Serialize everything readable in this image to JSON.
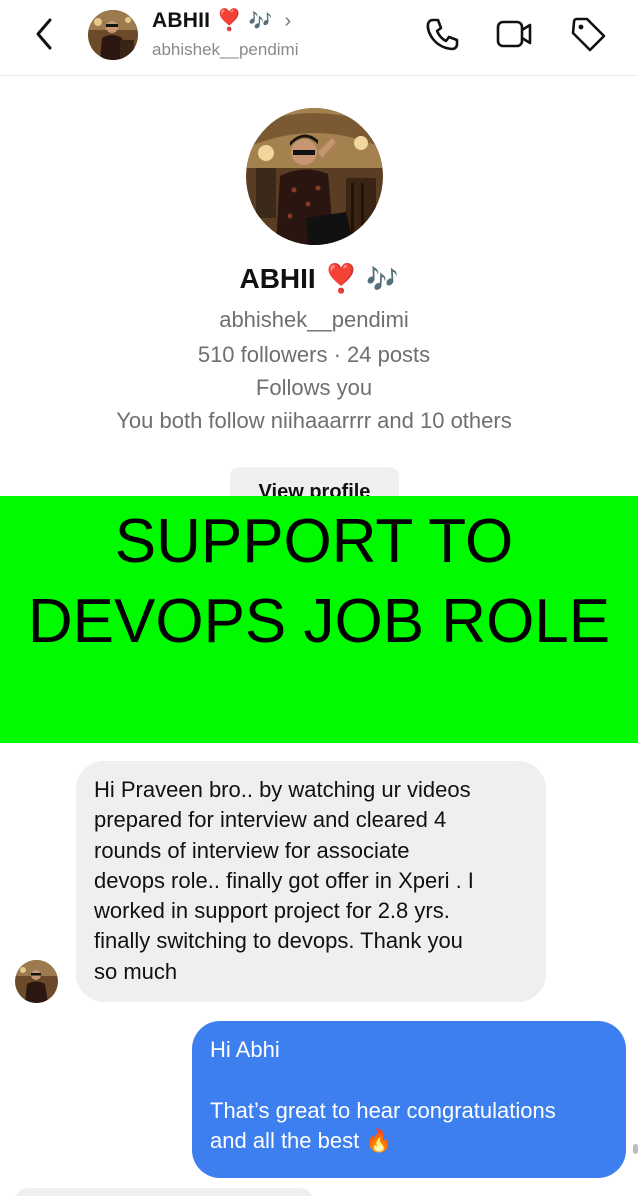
{
  "header": {
    "name": "ABHII",
    "heart": "❣️",
    "notes": "🎶",
    "chevron": "›",
    "handle": "abhishek__pendimi",
    "icons": [
      "back-chevron-icon",
      "phone-icon",
      "video-camera-icon",
      "tag-icon"
    ]
  },
  "profile": {
    "name": "ABHII",
    "heart": "❣️",
    "notes": "🎶",
    "handle": "abhishek__pendimi",
    "stats": "510 followers · 24 posts",
    "follows_you": "Follows you",
    "mutual": "You both follow niihaaarrrr and 10 others",
    "view_profile_label": "View profile"
  },
  "banner": {
    "line1": "SUPPORT TO",
    "line2": "DEVOPS JOB ROLE",
    "color": "#00FA00"
  },
  "messages": [
    {
      "direction": "incoming",
      "text": "Hi Praveen bro.. by watching ur videos\nprepared for interview and cleared 4\nrounds of interview for associate\ndevops role.. finally got offer in Xperi . I\nworked in support project for 2.8 yrs.\nfinally switching to devops. Thank you\nso much"
    },
    {
      "direction": "outgoing",
      "text": "Hi Abhi\n\nThat’s great to hear congratulations\nand all the best ",
      "emoji": "🔥"
    }
  ],
  "colors": {
    "outgoing_bubble": "#3D7FEE",
    "incoming_bubble": "#EFEFEF",
    "heart": "#E0245E"
  }
}
